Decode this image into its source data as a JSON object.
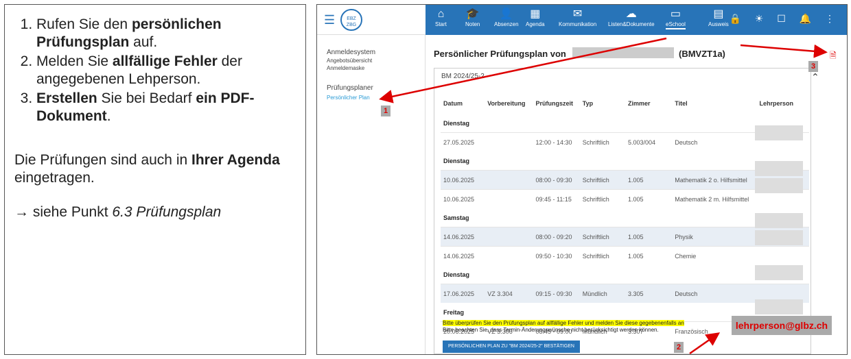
{
  "instructions": {
    "steps": [
      {
        "num": "1.",
        "pre": "Rufen Sie den ",
        "bold": "persönlichen Prüfungsplan",
        "post": " auf."
      },
      {
        "num": "2.",
        "pre": "Melden Sie ",
        "bold": "allfällige Fehler",
        "post": " der angegebenen Lehperson."
      },
      {
        "num": "3.",
        "bold": "Erstellen",
        "mid": " Sie bei Bedarf ",
        "bold2": "ein PDF-Dokument",
        "post": "."
      }
    ],
    "agenda_pre": "Die Prüfungen sind auch in ",
    "agenda_bold": "Ihrer Agenda",
    "agenda_post": " eingetragen.",
    "see_pre": "→ siehe Punkt ",
    "see_ref": "6.3 Prüfungsplan"
  },
  "app": {
    "logo_text": "EBZ ZBG",
    "nav": [
      {
        "label": "Start",
        "icon": "home-icon",
        "glyph": "⌂"
      },
      {
        "label": "Noten",
        "icon": "graduation-cap-icon",
        "glyph": "🎓"
      },
      {
        "label": "Absenzen",
        "icon": "user-edit-icon",
        "glyph": "👤"
      },
      {
        "label": "Agenda",
        "icon": "calendar-icon",
        "glyph": "▦"
      },
      {
        "label": "Kommunikation",
        "icon": "mail-icon",
        "glyph": "✉"
      },
      {
        "label": "Listen&Dokumente",
        "icon": "cloud-icon",
        "glyph": "☁"
      },
      {
        "label": "eSchool",
        "icon": "laptop-icon",
        "glyph": "▭"
      },
      {
        "label": "Ausweis",
        "icon": "id-card-icon",
        "glyph": "▤"
      }
    ],
    "right_icons": "🔒 ☀ ☐ 🔔 ⋮",
    "sidebar": {
      "section1": "Anmeldesystem",
      "sub1": "Angebotsübersicht",
      "sub2": "Anmeldemaske",
      "section2": "Prüfungsplaner",
      "link": "Persönlicher Plan"
    },
    "title": "Persönlicher Prüfungsplan von",
    "class_code": "(BMVZT1a)",
    "card_title": "BM 2024/25-2",
    "columns": [
      "Datum",
      "Vorbereitung",
      "Prüfungszeit",
      "Typ",
      "Zimmer",
      "Titel",
      "Lehrperson"
    ],
    "groups": [
      {
        "day": "Dienstag",
        "rows": [
          [
            "27.05.2025",
            "",
            "12:00 - 14:30",
            "Schriftlich",
            "5.003/004",
            "Deutsch"
          ]
        ]
      },
      {
        "day": "Dienstag",
        "rows": [
          [
            "10.06.2025",
            "",
            "08:00 - 09:30",
            "Schriftlich",
            "1.005",
            "Mathematik 2 o. Hilfsmittel"
          ],
          [
            "10.06.2025",
            "",
            "09:45 - 11:15",
            "Schriftlich",
            "1.005",
            "Mathematik 2 m. Hilfsmittel"
          ]
        ]
      },
      {
        "day": "Samstag",
        "rows": [
          [
            "14.06.2025",
            "",
            "08:00 - 09:20",
            "Schriftlich",
            "1.005",
            "Physik"
          ],
          [
            "14.06.2025",
            "",
            "09:50 - 10:30",
            "Schriftlich",
            "1.005",
            "Chemie"
          ]
        ]
      },
      {
        "day": "Dienstag",
        "rows": [
          [
            "17.06.2025",
            "VZ 3.304",
            "09:15 - 09:30",
            "Mündlich",
            "3.305",
            "Deutsch"
          ]
        ]
      },
      {
        "day": "Freitag",
        "rows": [
          [
            "20.06.2025",
            "VZ 3.306",
            "08:45 - 09:00",
            "Mündlich",
            "3.307",
            "Französisch"
          ]
        ]
      }
    ],
    "notice1": "Bitte überprüfen Sie den Prüfungsplan auf allfällige Fehler und melden Sie diese gegebenenfalls an",
    "notice2": "Bitte beachten Sie, dass Termin-Änderungswünsche nicht berücksichtigt werden können.",
    "email": "lehrperson@glbz.ch",
    "confirm_label": "PERSÖNLICHEN PLAN ZU \"BM 2024/25-2\" BESTÄTIGEN",
    "badges": [
      "1",
      "2",
      "3"
    ],
    "colors": {
      "nav": "#2874b8",
      "annotation": "#dd0000",
      "highlight": "#ffff00"
    }
  }
}
